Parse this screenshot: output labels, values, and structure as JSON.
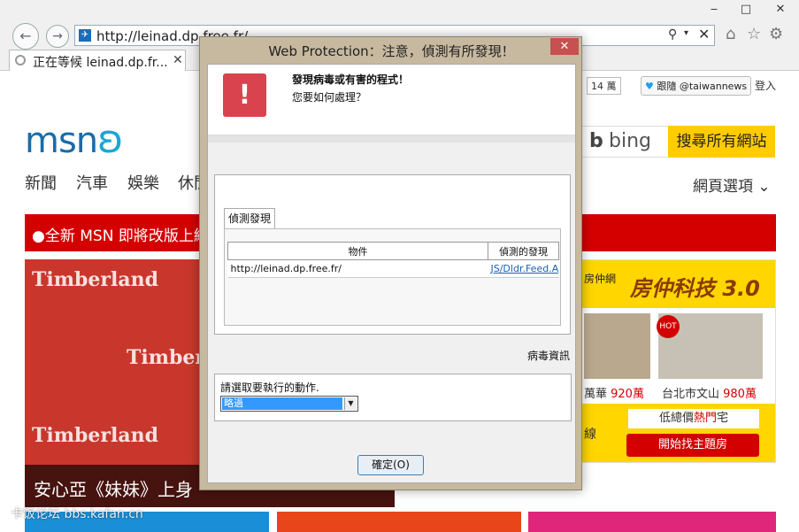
{
  "browser": {
    "window_controls": {
      "minimize": "‒",
      "maximize": "□",
      "close": "✕"
    },
    "back_icon": "←",
    "forward_icon": "→",
    "address": {
      "url": "http://leinad.dp.free.fr/",
      "favicon": "✈",
      "search_icon": "⚲",
      "dropdown_icon": "▾",
      "stop_icon": "✕"
    },
    "toolbar": {
      "home_icon": "⌂",
      "favorites_icon": "☆",
      "tools_icon": "⚙"
    },
    "tab": {
      "label": "正在等候 leinad.dp.fr...",
      "close_icon": "✕"
    }
  },
  "page": {
    "fb_count": "14 萬",
    "twitter_follow": {
      "bird": "♥",
      "text": "跟隨 @taiwannews"
    },
    "signin": "登入",
    "logo": {
      "text": "msn",
      "butterfly": "ʚ"
    },
    "bing": {
      "b": "b",
      "label": "bing"
    },
    "search_button": "搜尋所有網站",
    "nav": [
      "新聞",
      "汽車",
      "娛樂",
      "休閒"
    ],
    "web_options": "網頁選項 ⌄",
    "banner": "●全新 MSN 即將改版上線",
    "hero": {
      "brand_marks": [
        "Timberland",
        "Timberland",
        "Timberland"
      ],
      "caption": "安心亞《妹妹》上身"
    },
    "ad": {
      "brand": "房仲網",
      "title": "房仲科技 3.0",
      "hot": "HOT",
      "price1_label": "萬華 ",
      "price1_value": "920萬",
      "price2_label": "台北市文山 ",
      "price2_value": "980萬",
      "partial": "線",
      "low_total_pre": "低總價",
      "low_total_hl": "熱門",
      "low_total_post": "宅",
      "cta": "開始找主題房"
    },
    "watermark": "卡饭论坛 bbs.kafan.cn"
  },
  "dialog": {
    "title": "Web Protection：注意，偵測有所發現！",
    "close_icon": "✕",
    "warning_icon": "!",
    "heading": "發現病毒或有害的程式！",
    "question": "您要如何處理？",
    "detection_tab": "偵測發現",
    "table": {
      "headers": [
        "物件",
        "偵測的發現"
      ],
      "rows": [
        {
          "object": "http://leinad.dp.free.fr/",
          "finding": "JS/Dldr.Feed.A"
        }
      ]
    },
    "virus_info_link": "病毒資訊",
    "action_label": "請選取要執行的動作.",
    "action_selected": "略過",
    "action_arrow": "▼",
    "ok_button": "確定(O)"
  }
}
